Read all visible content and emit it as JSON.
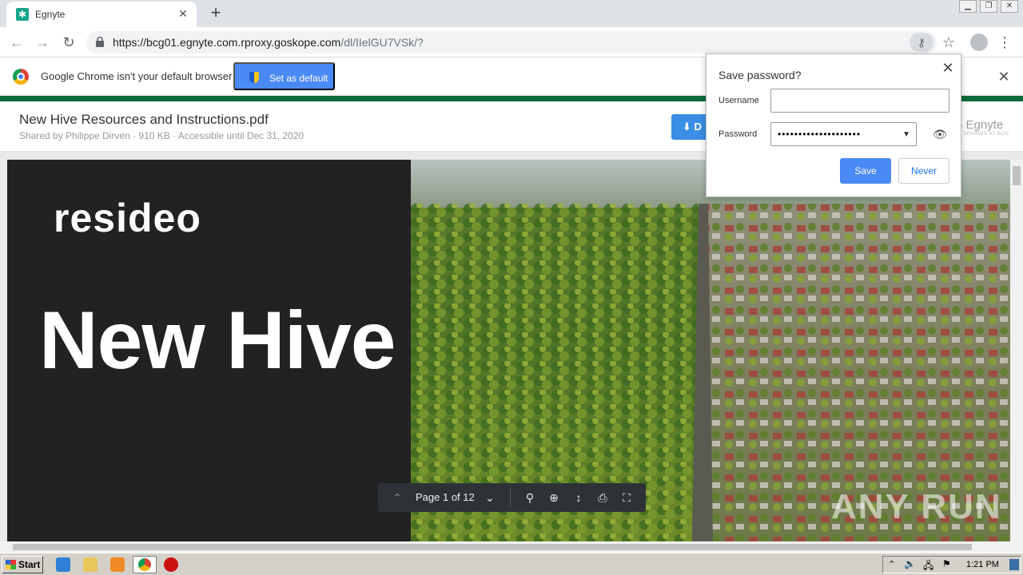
{
  "browser": {
    "tab_title": "Egnyte",
    "url_host": "https://bcg01.egnyte.com.rproxy.goskope.com",
    "url_path": "/dl/IIelGU7VSk/?"
  },
  "infobar": {
    "message": "Google Chrome isn't your default browser",
    "button_label": "Set as default"
  },
  "file": {
    "title": "New Hive Resources and Instructions.pdf",
    "meta": "Shared by Philippe Dirven  ·  910 KB  ·  Accessible until Dec 31, 2020",
    "download_label": "D",
    "brand": "n Egnyte",
    "brand_sub": "SHARING AT BCG"
  },
  "pdf_page": {
    "logo_text": "resideo",
    "heading": "New Hive"
  },
  "viewer_toolbar": {
    "page_indicator": "Page 1 of 12"
  },
  "password_popup": {
    "title": "Save password?",
    "username_label": "Username",
    "username_value": "",
    "password_label": "Password",
    "password_mask": "••••••••••••••••••••",
    "save_label": "Save",
    "never_label": "Never"
  },
  "watermark": "ANY RUN",
  "taskbar": {
    "start_label": "Start",
    "clock": "1:21 PM"
  },
  "colors": {
    "accent_blue": "#4a8af4",
    "egnyte_green": "#0b6b3a",
    "pdf_dark": "#222222"
  }
}
